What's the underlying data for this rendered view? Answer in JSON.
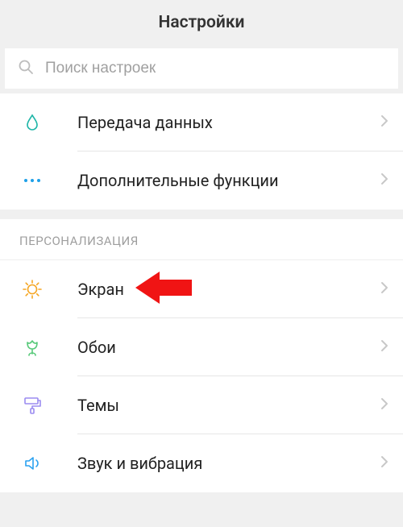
{
  "header": {
    "title": "Настройки"
  },
  "search": {
    "placeholder": "Поиск настроек"
  },
  "top_items": [
    {
      "label": "Передача данных"
    },
    {
      "label": "Дополнительные функции"
    }
  ],
  "section_title": "ПЕРСОНАЛИЗАЦИЯ",
  "personal_items": [
    {
      "label": "Экран"
    },
    {
      "label": "Обои"
    },
    {
      "label": "Темы"
    },
    {
      "label": "Звук и вибрация"
    }
  ],
  "colors": {
    "accent_teal": "#1fb6a8",
    "accent_orange": "#f5a623",
    "accent_green": "#58c97a",
    "accent_purple": "#9b8cf0",
    "accent_blue": "#2aa1f0",
    "dots_blue": "#1fa0e8",
    "callout_red": "#f01414"
  }
}
